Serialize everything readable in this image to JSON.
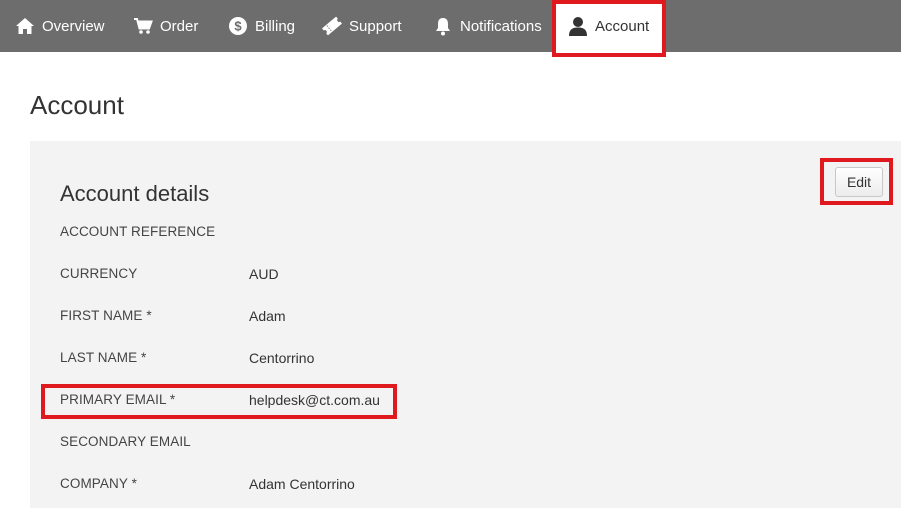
{
  "nav": {
    "items": [
      {
        "label": "Overview",
        "icon": "home-icon"
      },
      {
        "label": "Order",
        "icon": "cart-icon"
      },
      {
        "label": "Billing",
        "icon": "dollar-icon"
      },
      {
        "label": "Support",
        "icon": "ticket-icon"
      },
      {
        "label": "Notifications",
        "icon": "bell-icon"
      },
      {
        "label": "Account",
        "icon": "user-icon",
        "active": true
      }
    ]
  },
  "page": {
    "title": "Account"
  },
  "account_details": {
    "title": "Account details",
    "edit_label": "Edit",
    "fields": [
      {
        "label": "ACCOUNT REFERENCE",
        "value": ""
      },
      {
        "label": "CURRENCY",
        "value": "AUD"
      },
      {
        "label": "FIRST NAME *",
        "value": "Adam"
      },
      {
        "label": "LAST NAME *",
        "value": "Centorrino"
      },
      {
        "label": "PRIMARY EMAIL *",
        "value": "helpdesk@ct.com.au"
      },
      {
        "label": "SECONDARY EMAIL",
        "value": ""
      },
      {
        "label": "COMPANY *",
        "value": "Adam Centorrino"
      }
    ]
  },
  "colors": {
    "navbar": "#6d6d6d",
    "highlight": "#e0191e",
    "panel": "#f3f3f3"
  }
}
